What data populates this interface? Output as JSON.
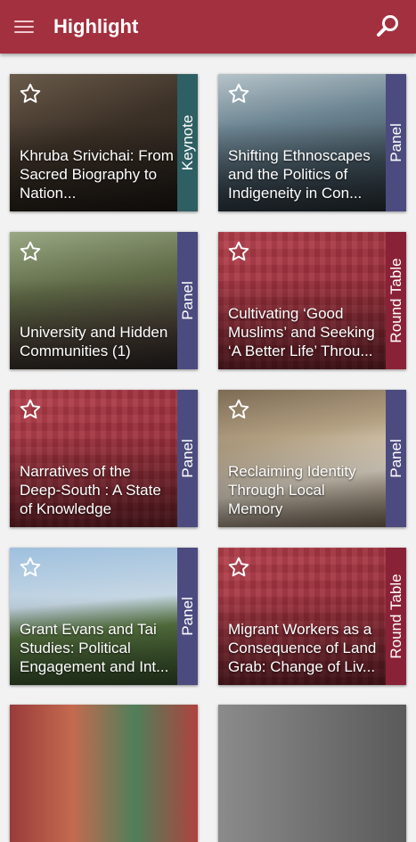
{
  "app": {
    "title": "Highlight"
  },
  "icons": {
    "menu": "menu-icon",
    "search": "search-icon",
    "star": "star-outline-icon"
  },
  "colors": {
    "appbar": "#a3303f",
    "strip_keynote": "#2e5f63",
    "strip_panel": "#4c4b7f",
    "strip_round_table": "#8a2237"
  },
  "cards": [
    {
      "title": "Khruba Srivichai: From Sacred Biography to Nation...",
      "type": "Keynote",
      "strip_color": "#2e5f63"
    },
    {
      "title": "Shifting Ethnoscapes and the Politics of Indigeneity in Con...",
      "type": "Panel",
      "strip_color": "#4c4b7f"
    },
    {
      "title": "University and Hidden Communities (1)",
      "type": "Panel",
      "strip_color": "#4c4b7f"
    },
    {
      "title": "Cultivating ‘Good Muslims’ and Seeking ‘A Better Life’ Throu...",
      "type": "Round Table",
      "strip_color": "#8a2237"
    },
    {
      "title": "Narratives of the Deep-South : A State of Knowledge",
      "type": "Panel",
      "strip_color": "#4c4b7f"
    },
    {
      "title": "Reclaiming Identity Through Local Memory",
      "type": "Panel",
      "strip_color": "#4c4b7f"
    },
    {
      "title": "Grant Evans and Tai Studies: Political Engagement and Int...",
      "type": "Panel",
      "strip_color": "#4c4b7f"
    },
    {
      "title": "Migrant Workers as a Consequence of Land Grab: Change of Liv...",
      "type": "Round Table",
      "strip_color": "#8a2237"
    }
  ]
}
